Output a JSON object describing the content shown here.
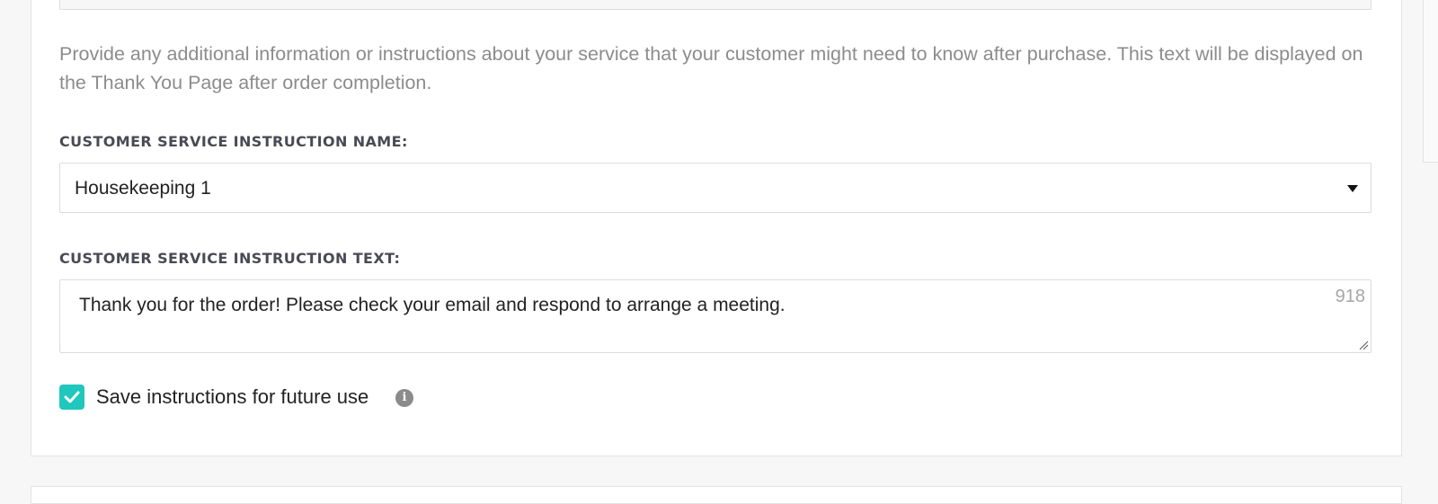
{
  "description": "Provide any additional information or instructions about your service that your customer might need to know after purchase. This text will be displayed on the Thank You Page after order completion.",
  "instruction_name": {
    "label": "CUSTOMER SERVICE INSTRUCTION NAME:",
    "selected_value": "Housekeeping 1"
  },
  "instruction_text": {
    "label": "CUSTOMER SERVICE INSTRUCTION TEXT:",
    "value": "Thank you for the order! Please check your email and respond to arrange a meeting.",
    "remaining_chars": "918"
  },
  "save_option": {
    "label": "Save instructions for future use",
    "checked": true
  },
  "icons": {
    "info": "info-icon",
    "checkbox_check": "checkmark-icon",
    "select_caret": "caret-down-icon"
  },
  "colors": {
    "accent": "#1fc7bd",
    "muted_text": "#8c8c8c",
    "label_text": "#4a4a55"
  }
}
